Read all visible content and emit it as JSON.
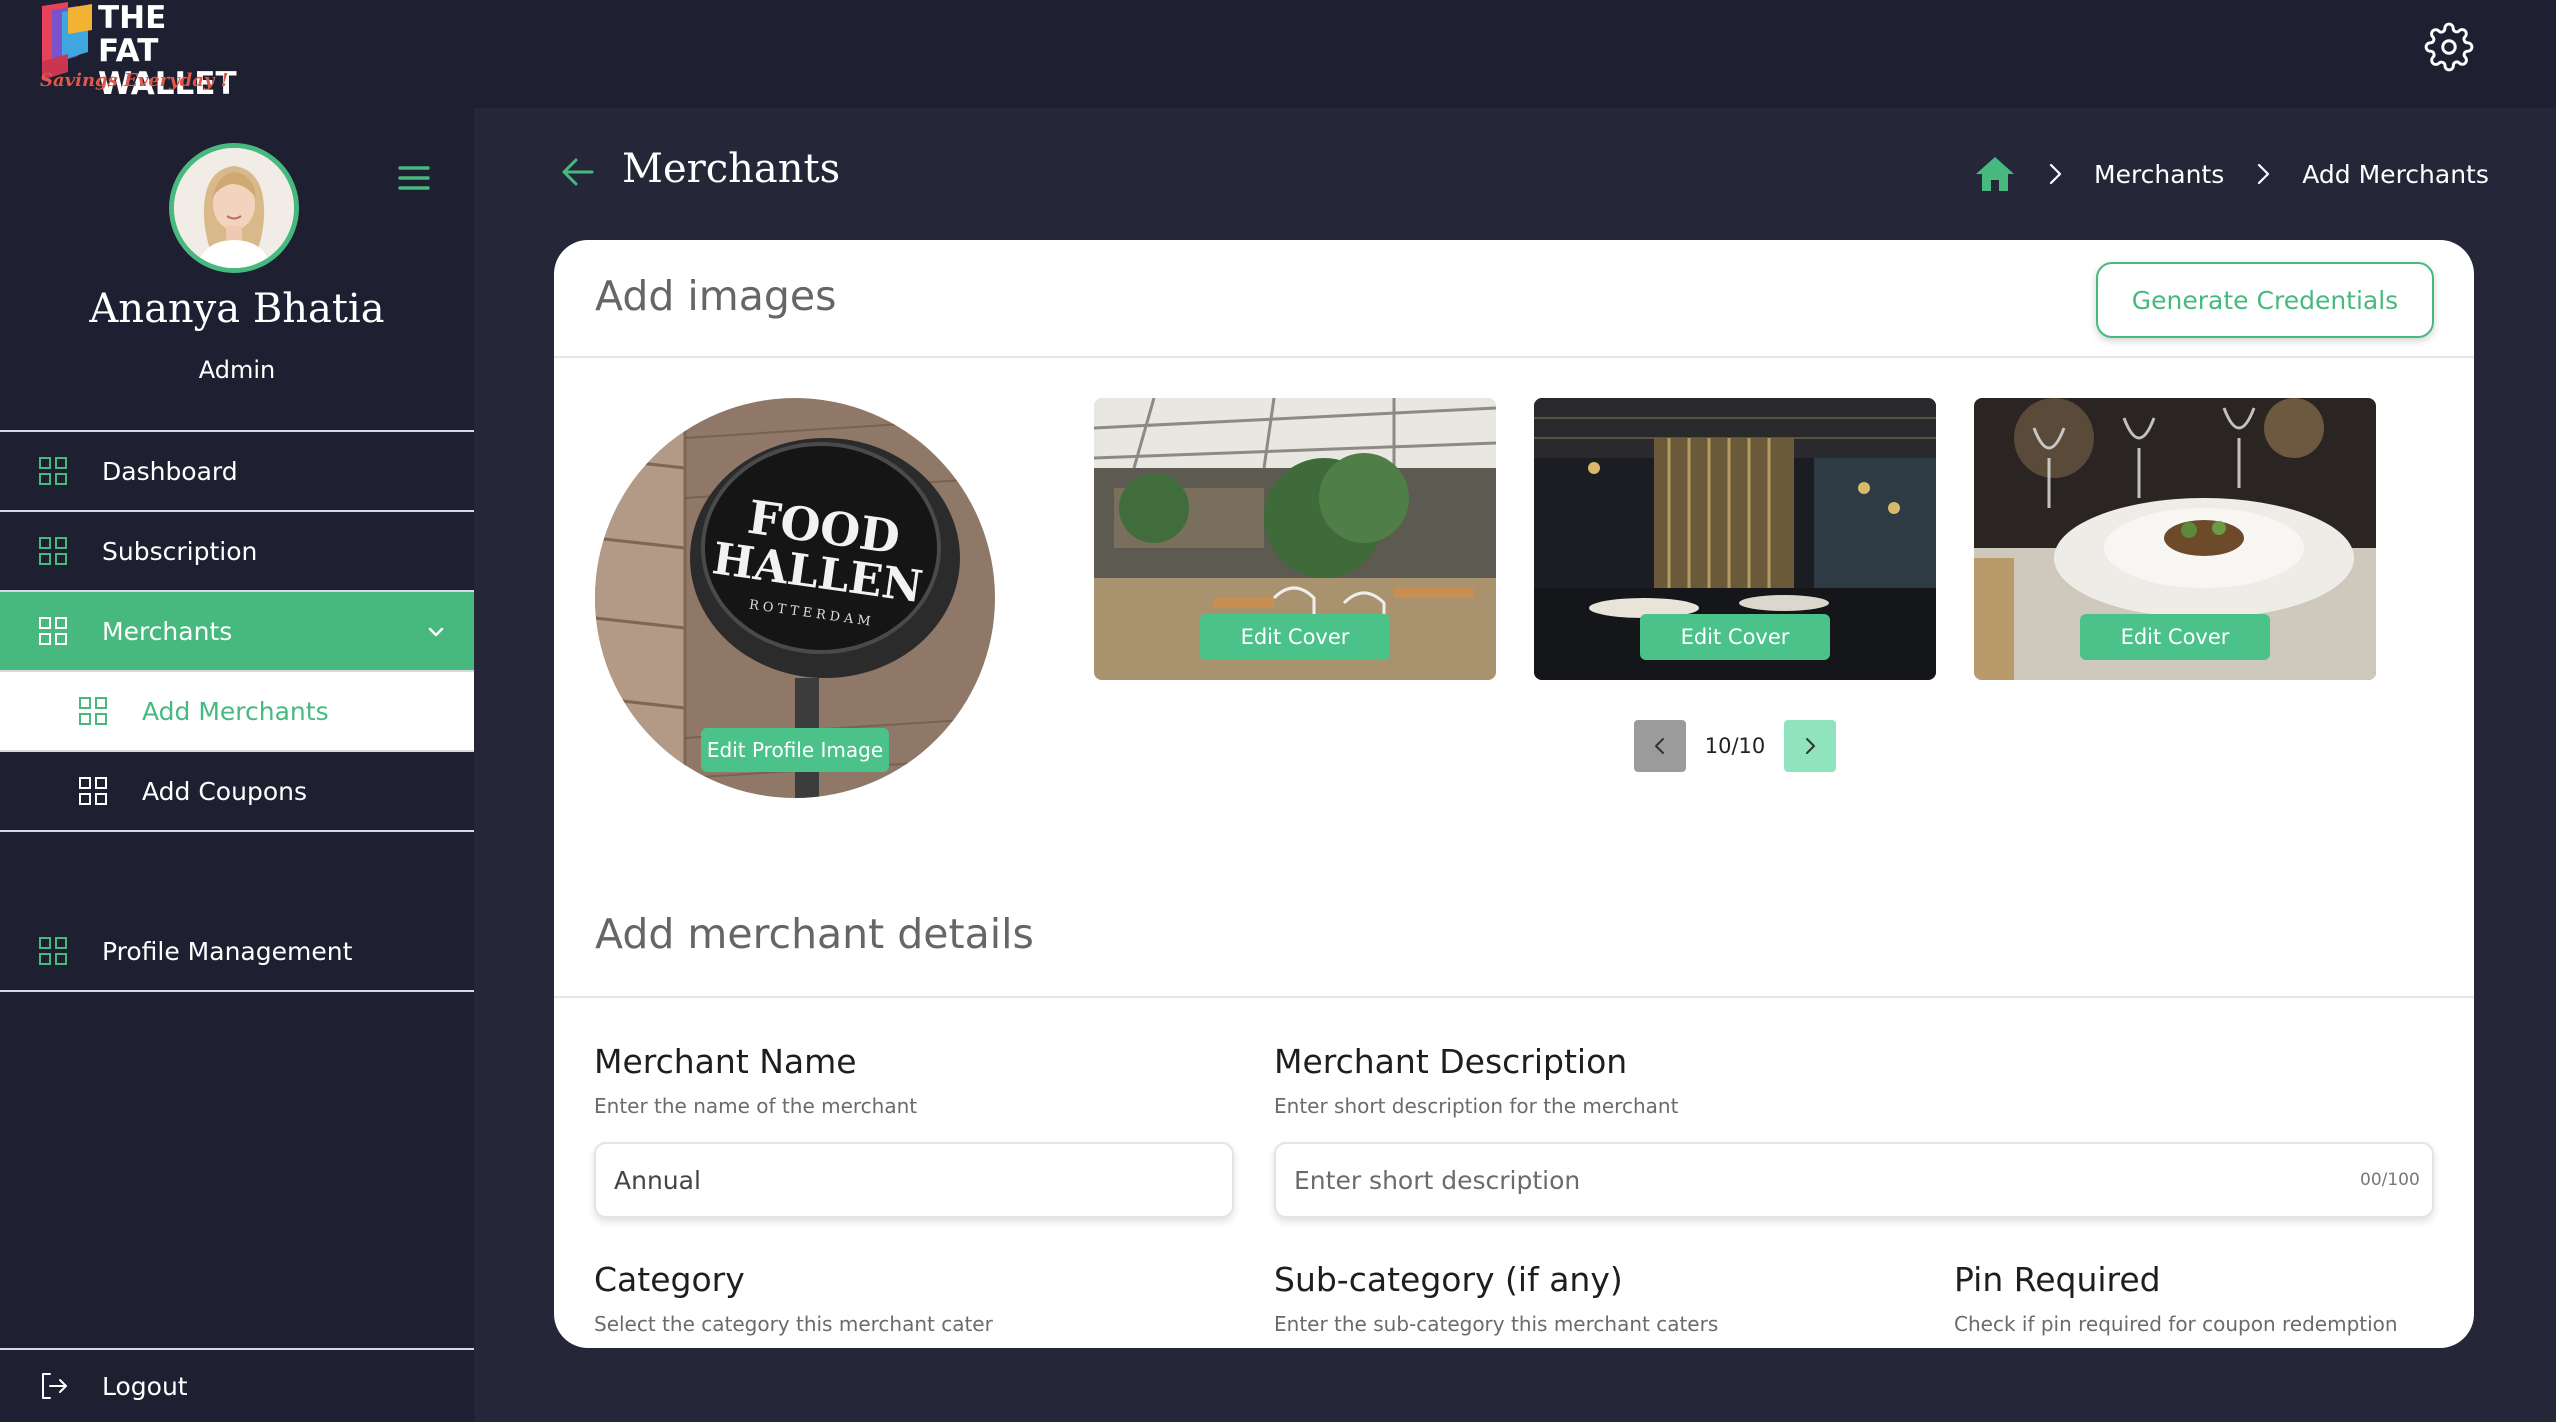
{
  "brand": {
    "title": "THE FAT WALLET",
    "tagline": "Savings Everyday !"
  },
  "icons": {
    "settings": "gear-icon",
    "menu": "hamburger-icon",
    "back": "arrow-left-icon",
    "home": "home-icon",
    "nav": "grid-icon",
    "logout": "logout-icon"
  },
  "colors": {
    "accent": "#48b97e",
    "sidebar_bg": "#1f1f32",
    "page_bg": "#262639",
    "card_bg": "#ffffff"
  },
  "user": {
    "name": "Ananya Bhatia",
    "role": "Admin"
  },
  "sidebar": {
    "items": [
      {
        "label": "Dashboard"
      },
      {
        "label": "Subscription"
      },
      {
        "label": "Merchants"
      },
      {
        "label": "Add Merchants"
      },
      {
        "label": "Add Coupons"
      },
      {
        "label": "Profile Management"
      }
    ],
    "logout_label": "Logout"
  },
  "header": {
    "title": "Merchants",
    "breadcrumb": [
      "Merchants",
      "Add Merchants"
    ]
  },
  "images_section": {
    "title": "Add images",
    "generate_button": "Generate Credentials",
    "profile_sign": {
      "line1": "FOOD",
      "line2": "HALLEN",
      "line3": "ROTTERDAM"
    },
    "edit_profile_label": "Edit Profile Image",
    "covers": [
      {
        "label": "Edit Cover"
      },
      {
        "label": "Edit Cover"
      },
      {
        "label": "Edit Cover"
      }
    ],
    "pager": {
      "current": "10/10"
    }
  },
  "details_section": {
    "title": "Add merchant details",
    "merchant_name": {
      "label": "Merchant Name",
      "help": "Enter the name of the merchant",
      "value": "Annual"
    },
    "merchant_description": {
      "label": "Merchant Description",
      "help": "Enter short description for the merchant",
      "placeholder": "Enter short description",
      "counter": "00/100"
    },
    "category": {
      "label": "Category",
      "help": "Select the category this merchant cater"
    },
    "sub_category": {
      "label": "Sub-category (if any)",
      "help": "Enter the sub-category this merchant caters"
    },
    "pin_required": {
      "label": "Pin Required",
      "help": "Check if pin required for coupon redemption"
    }
  }
}
